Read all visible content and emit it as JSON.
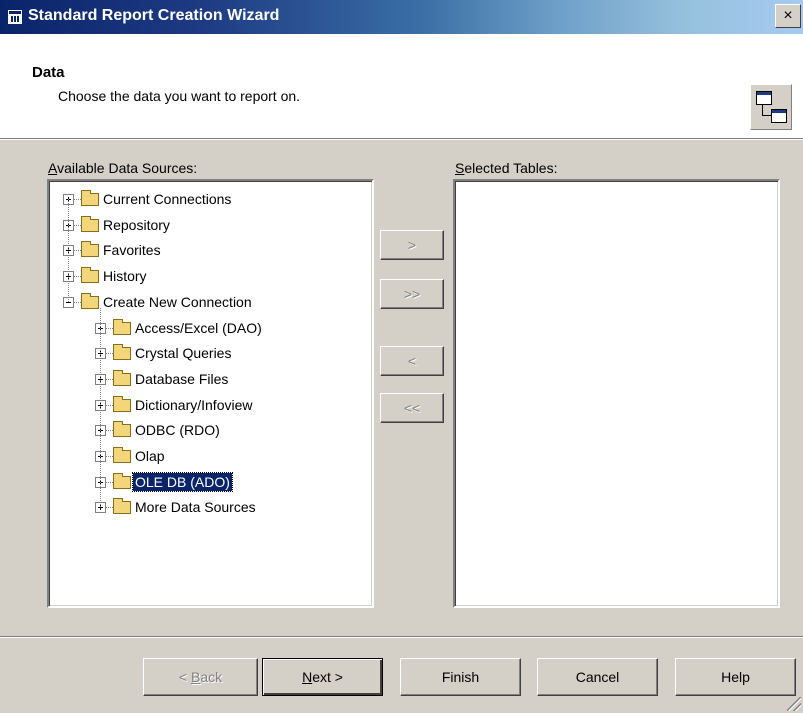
{
  "window": {
    "title": "Standard Report Creation Wizard",
    "close_label": "×"
  },
  "header": {
    "title": "Data",
    "subtitle": "Choose the data you want to report on."
  },
  "available": {
    "label_accel": "A",
    "label_rest": "vailable Data Sources:",
    "tree": [
      {
        "label": "Current Connections",
        "level": 0,
        "expander": "plus"
      },
      {
        "label": "Repository",
        "level": 0,
        "expander": "plus"
      },
      {
        "label": "Favorites",
        "level": 0,
        "expander": "plus"
      },
      {
        "label": "History",
        "level": 0,
        "expander": "plus"
      },
      {
        "label": "Create New Connection",
        "level": 0,
        "expander": "minus"
      },
      {
        "label": "Access/Excel (DAO)",
        "level": 1,
        "expander": "plus"
      },
      {
        "label": "Crystal Queries",
        "level": 1,
        "expander": "plus"
      },
      {
        "label": "Database Files",
        "level": 1,
        "expander": "plus"
      },
      {
        "label": "Dictionary/Infoview",
        "level": 1,
        "expander": "plus"
      },
      {
        "label": "ODBC (RDO)",
        "level": 1,
        "expander": "plus"
      },
      {
        "label": "Olap",
        "level": 1,
        "expander": "plus"
      },
      {
        "label": "OLE DB (ADO)",
        "level": 1,
        "expander": "plus",
        "selected": true
      },
      {
        "label": "More Data Sources",
        "level": 1,
        "expander": "plus"
      }
    ]
  },
  "selected": {
    "label_accel": "S",
    "label_rest": "elected Tables:",
    "items": []
  },
  "transfer": {
    "add_one": ">",
    "add_all": ">>",
    "remove_one": "<",
    "remove_all": "<<"
  },
  "footer": {
    "back_prefix": "< ",
    "back_accel": "B",
    "back_rest": "ack",
    "next_accel": "N",
    "next_rest": "ext >",
    "finish": "Finish",
    "cancel": "Cancel",
    "help": "Help"
  },
  "colors": {
    "title_start": "#0a246a",
    "title_end": "#a6caf0",
    "selection": "#0a246a",
    "face": "#d4d0c8"
  }
}
